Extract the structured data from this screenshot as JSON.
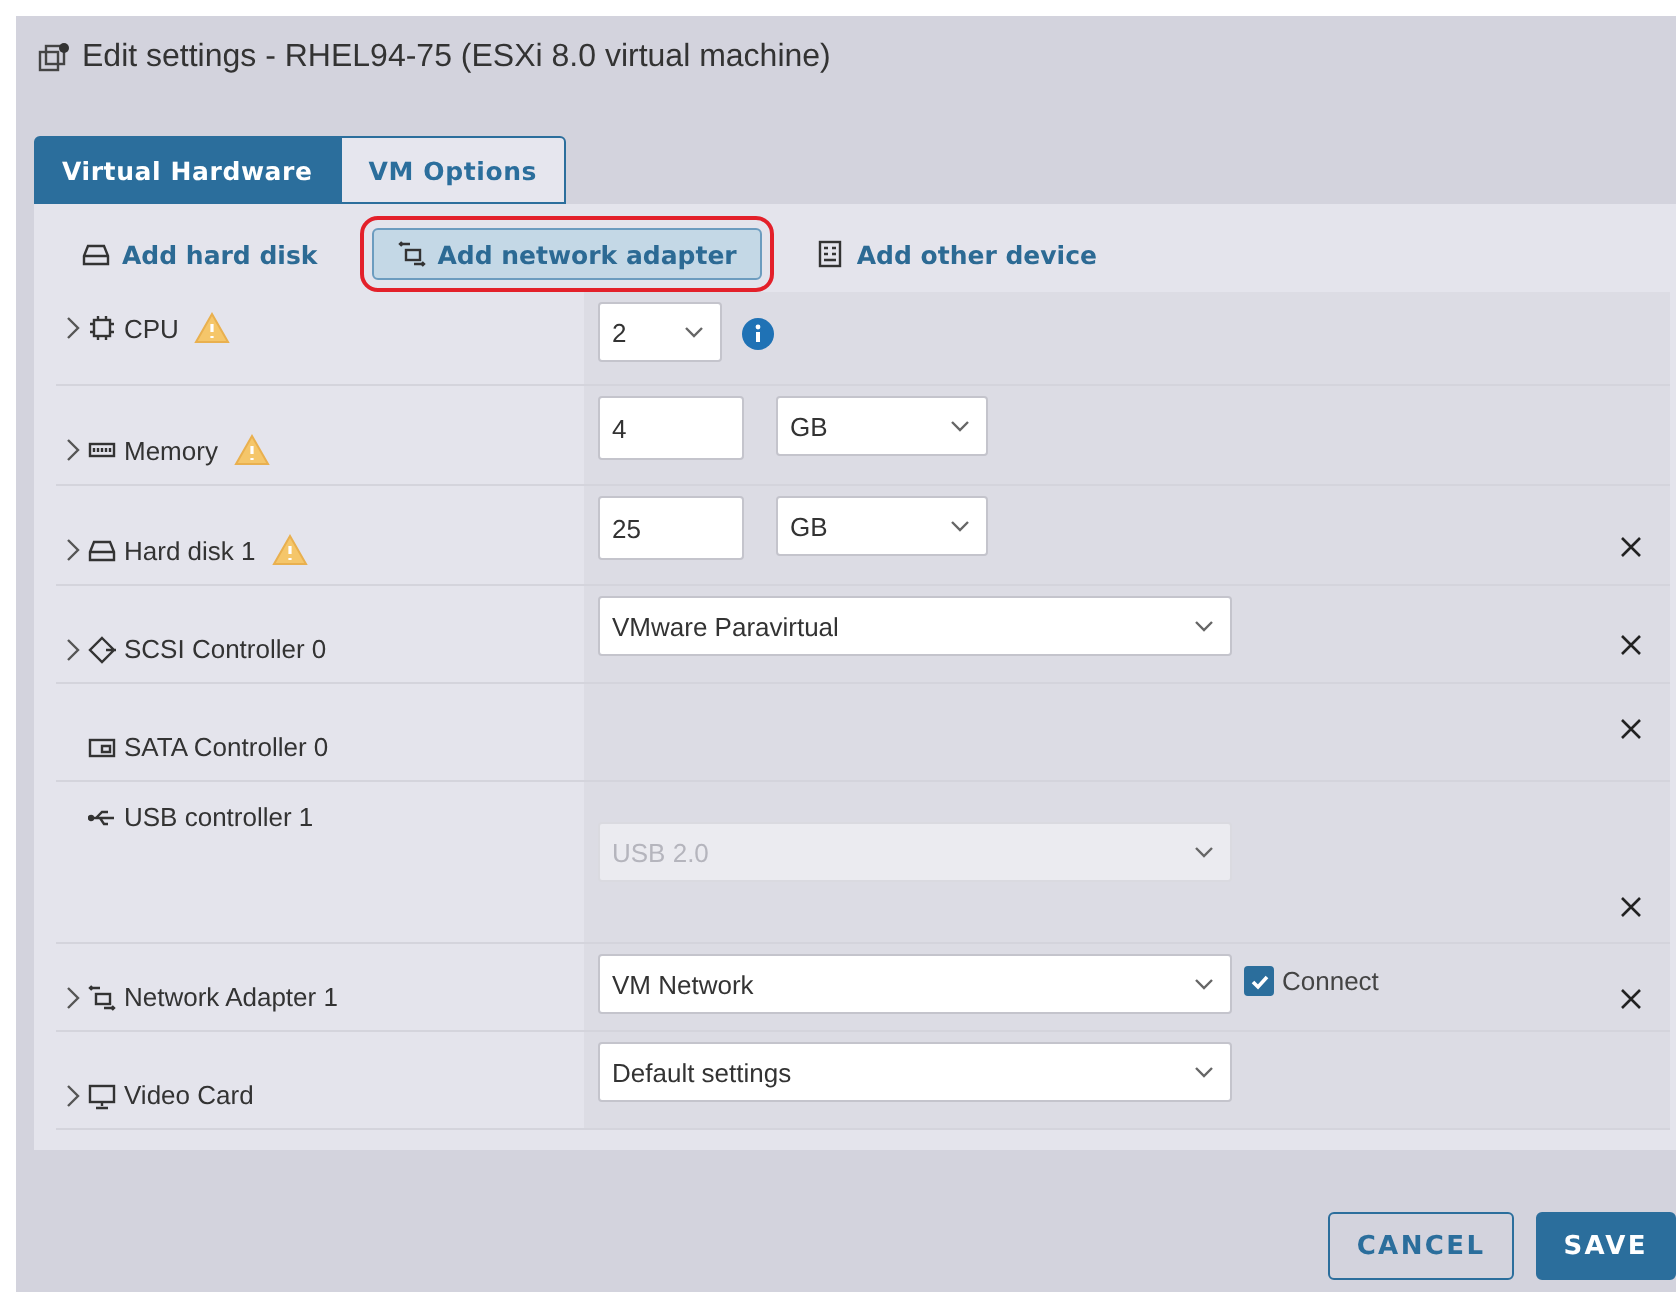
{
  "dialog": {
    "title": "Edit settings - RHEL94-75 (ESXi 8.0 virtual machine)"
  },
  "tabs": [
    {
      "label": "Virtual Hardware",
      "selected": true
    },
    {
      "label": "VM Options",
      "selected": false
    }
  ],
  "toolbar": [
    {
      "kind": "disk",
      "label": "Add hard disk",
      "highlighted": false
    },
    {
      "kind": "network",
      "label": "Add network adapter",
      "highlighted": true
    },
    {
      "kind": "device",
      "label": "Add other device",
      "highlighted": false
    }
  ],
  "devices": [
    {
      "kind": "cpu",
      "label": "CPU",
      "expandable": true,
      "warning": true,
      "removable": false,
      "controls": [
        {
          "kind": "count_select",
          "value": "2",
          "disabled": false
        },
        {
          "kind": "info"
        }
      ]
    },
    {
      "kind": "memory",
      "label": "Memory",
      "expandable": true,
      "warning": true,
      "removable": false,
      "controls": [
        {
          "kind": "input",
          "value": "4"
        },
        {
          "kind": "unit_select",
          "value": "GB",
          "disabled": false
        }
      ]
    },
    {
      "kind": "disk",
      "label": "Hard disk 1",
      "expandable": true,
      "warning": true,
      "removable": true,
      "controls": [
        {
          "kind": "input",
          "value": "25"
        },
        {
          "kind": "unit_select",
          "value": "GB",
          "disabled": false
        }
      ]
    },
    {
      "kind": "scsi",
      "label": "SCSI Controller 0",
      "expandable": true,
      "warning": false,
      "removable": true,
      "controls": [
        {
          "kind": "wide_select",
          "value": "VMware Paravirtual",
          "disabled": false
        }
      ]
    },
    {
      "kind": "sata",
      "label": "SATA Controller 0",
      "expandable": false,
      "warning": false,
      "removable": true
    },
    {
      "kind": "usb",
      "label": "USB controller 1",
      "expandable": false,
      "warning": false,
      "removable": true,
      "controls": [
        {
          "kind": "wide_select",
          "value": "USB 2.0",
          "disabled": true
        }
      ]
    },
    {
      "kind": "network",
      "label": "Network Adapter 1",
      "expandable": true,
      "warning": false,
      "removable": true,
      "controls": [
        {
          "kind": "wide_select",
          "value": "VM Network",
          "disabled": false
        },
        {
          "kind": "checkbox",
          "label": "Connect",
          "checked": true
        }
      ]
    },
    {
      "kind": "video",
      "label": "Video Card",
      "expandable": true,
      "warning": false,
      "removable": false,
      "controls": [
        {
          "kind": "wide_select",
          "value": "Default settings",
          "disabled": false
        }
      ]
    }
  ],
  "buttons": [
    {
      "kind": "secondary",
      "label": "CANCEL"
    },
    {
      "kind": "primary",
      "label": "SAVE"
    }
  ]
}
